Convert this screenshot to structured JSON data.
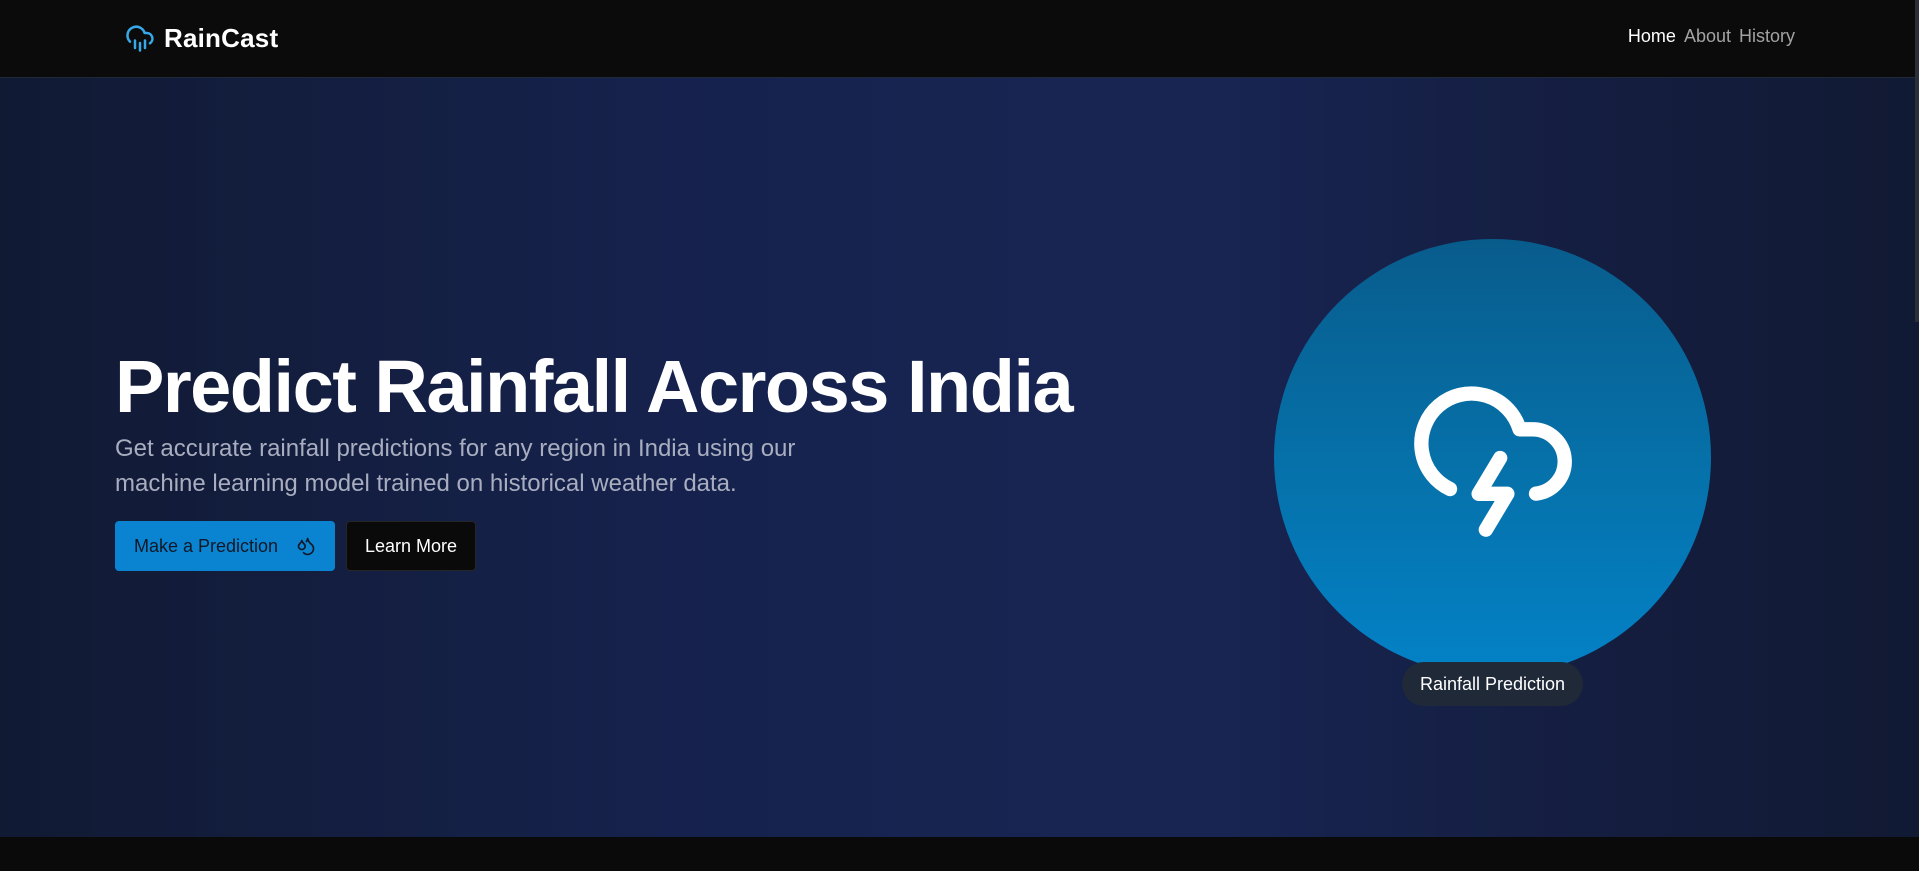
{
  "header": {
    "brand": "RainCast",
    "nav": [
      {
        "label": "Home",
        "active": true
      },
      {
        "label": "About",
        "active": false
      },
      {
        "label": "History",
        "active": false
      }
    ]
  },
  "hero": {
    "title": "Predict Rainfall Across India",
    "description": "Get accurate rainfall predictions for any region in India using our machine learning model trained on historical weather data.",
    "primary_button": "Make a Prediction",
    "secondary_button": "Learn More",
    "badge": "Rainfall Prediction"
  },
  "icons": {
    "brand": "cloud-rain-icon",
    "primary_button": "droplets-icon",
    "illustration": "cloud-lightning-icon"
  },
  "colors": {
    "accent": "#0a84d1",
    "nav_bg": "#0b0b0b",
    "hero_bg": "#16224d",
    "circle_top": "#085c8c",
    "circle_bottom": "#0382c7",
    "badge_bg": "#1f2937",
    "muted_text": "#a8aebf"
  }
}
